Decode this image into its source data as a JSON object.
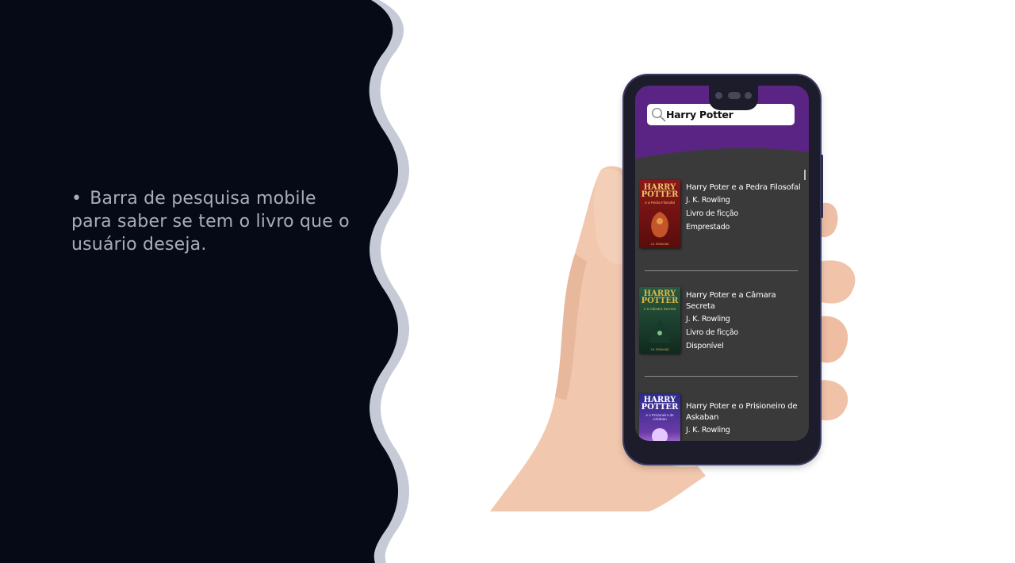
{
  "slide": {
    "bullet_symbol": "•",
    "bullet_text": "Barra de pesquisa mobile para saber se tem o livro que o usuário deseja."
  },
  "colors": {
    "panel_dark": "#050a16",
    "wave_border": "#c5cad6",
    "app_header_purple": "#5a2484",
    "list_background": "#3a3a3a"
  },
  "app": {
    "search": {
      "icon": "search-icon",
      "value": "Harry Potter"
    },
    "books": [
      {
        "title": "Harry Poter e a Pedra Filosofal",
        "author": "J. K. Rowling",
        "genre": "Livro de ficção",
        "status": "Emprestado",
        "cover": {
          "brand": "HARRY",
          "brand2": "POTTER",
          "subtitle": "e a Pedra Filosofal",
          "author_mark": "J.K. ROWLING",
          "color": "#7a1414"
        }
      },
      {
        "title": "Harry Poter e a Câmara Secreta",
        "author": "J. K. Rowling",
        "genre": "Livro de ficção",
        "status": "Disponível",
        "cover": {
          "brand": "HARRY",
          "brand2": "POTTER",
          "subtitle": "e a Câmara Secreta",
          "author_mark": "J.K. ROWLING",
          "color": "#1f4a36"
        }
      },
      {
        "title": "Harry Poter e o Prisioneiro de Askaban",
        "author": "J. K. Rowling",
        "cover": {
          "brand": "HARRY",
          "brand2": "POTTER",
          "subtitle": "e o Prisioneiro de Azkaban",
          "color": "#2a2a7a"
        }
      }
    ]
  }
}
